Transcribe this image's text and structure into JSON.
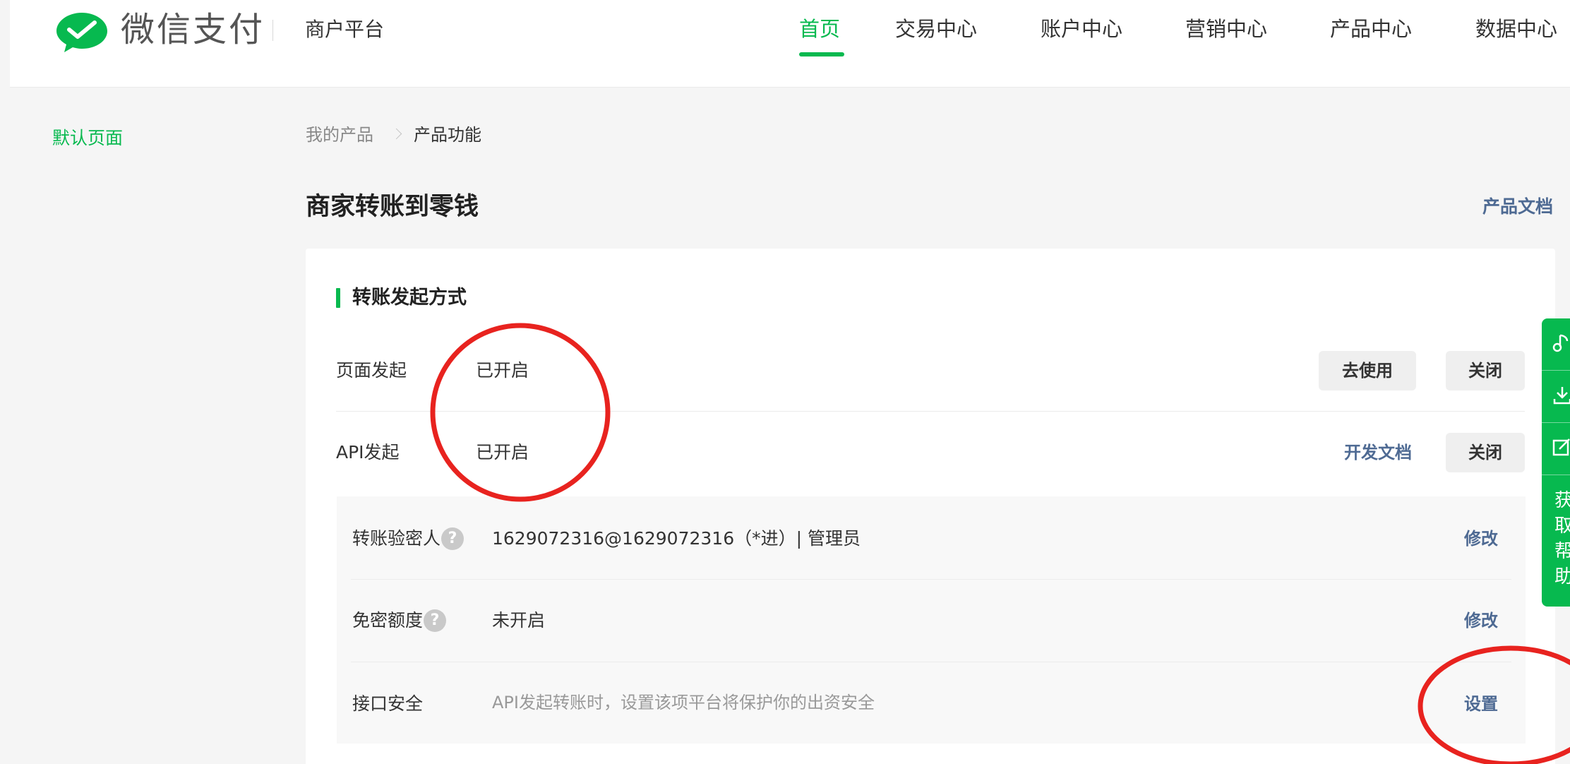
{
  "header": {
    "logo_text": "微信支付",
    "platform_name": "商户平台",
    "nav": [
      {
        "label": "首页",
        "active": true
      },
      {
        "label": "交易中心",
        "active": false
      },
      {
        "label": "账户中心",
        "active": false
      },
      {
        "label": "营销中心",
        "active": false
      },
      {
        "label": "产品中心",
        "active": false
      },
      {
        "label": "数据中心",
        "active": false
      }
    ]
  },
  "sidebar": {
    "items": [
      {
        "label": "默认页面"
      }
    ]
  },
  "breadcrumb": {
    "parent": "我的产品",
    "current": "产品功能"
  },
  "page": {
    "title": "商家转账到零钱",
    "doc_link": "产品文档"
  },
  "section": {
    "title": "转账发起方式",
    "rows": [
      {
        "label": "页面发起",
        "status": "已开启",
        "primary_action": "去使用",
        "secondary_action": "关闭"
      },
      {
        "label": "API发起",
        "status": "已开启",
        "primary_action": "开发文档",
        "secondary_action": "关闭"
      }
    ],
    "settings": [
      {
        "label": "转账验密人",
        "value": "1629072316@1629072316（*进）| 管理员",
        "action": "修改",
        "has_help": true
      },
      {
        "label": "免密额度",
        "value": "未开启",
        "action": "修改",
        "has_help": true
      },
      {
        "label": "接口安全",
        "value": "API发起转账时，设置该项平台将保护你的出资安全",
        "action": "设置",
        "has_help": false
      }
    ]
  },
  "float_toolbar": {
    "help_text": "获取帮助",
    "icons": [
      "music-note-icon",
      "download-icon",
      "edit-icon"
    ]
  },
  "help_glyph": "?",
  "colors": {
    "brand_green": "#07b94f",
    "link_blue": "#4e6a93",
    "annotation_red": "#e8231f"
  }
}
